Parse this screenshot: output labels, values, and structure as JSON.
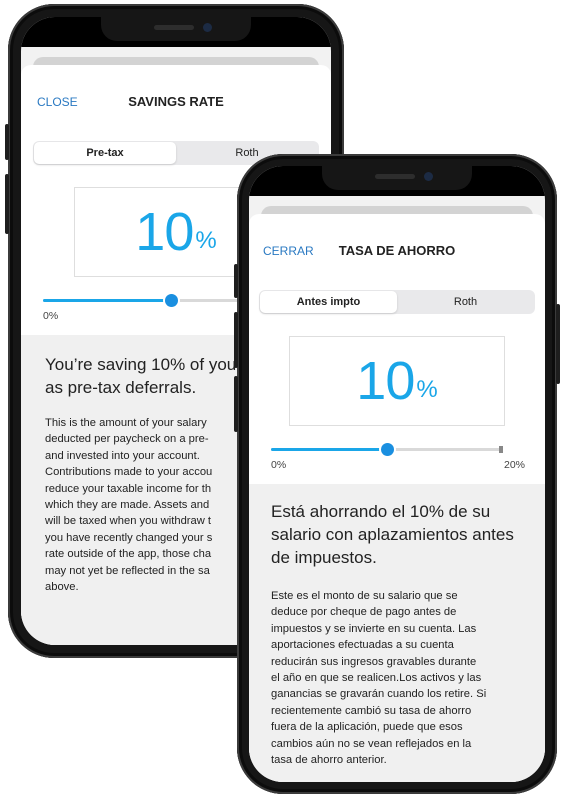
{
  "colors": {
    "accent": "#1aa6e8",
    "link": "#2a79c2",
    "panel": "#f0f0f0",
    "frame": "#161616"
  },
  "english_screen": {
    "close_label": "CLOSE",
    "title": "SAVINGS RATE",
    "tabs": [
      {
        "label": "Pre-tax",
        "selected": true
      },
      {
        "label": "Roth",
        "selected": false
      }
    ],
    "rate_value": "10",
    "rate_unit": "%",
    "slider_value_percent": 10,
    "slider_min_label": "0%",
    "heading_lines": [
      "You’re saving 10% of your",
      "as pre-tax deferrals."
    ],
    "body_lines": [
      "This is the amount of your salary",
      "deducted per paycheck on a pre-",
      "and invested into your account.",
      "Contributions made to your accou",
      "reduce your taxable income for th",
      "which they are made. Assets and",
      "will be taxed when you withdraw t",
      "you have recently changed your s",
      "rate outside of the app, those cha",
      "may not yet be reflected in the sa",
      "above."
    ]
  },
  "spanish_screen": {
    "close_label": "CERRAR",
    "title": "TASA DE AHORRO",
    "tabs": [
      {
        "label": "Antes impto",
        "selected": true
      },
      {
        "label": "Roth",
        "selected": false
      }
    ],
    "rate_value": "10",
    "rate_unit": "%",
    "slider_value_percent": 10,
    "slider_min_label": "0%",
    "slider_max_label": "20%",
    "heading_lines": [
      "Está ahorrando el 10% de su",
      "salario con aplazamientos antes",
      "de impuestos."
    ],
    "body_lines": [
      "Este es el monto de su salario que se",
      "deduce por cheque de pago antes de",
      "impuestos y se invierte en su cuenta. Las",
      "aportaciones efectuadas a su cuenta",
      "reducirán sus ingresos gravables durante",
      "el año en que se realicen.Los activos y las",
      "ganancias se gravarán cuando los retire. Si",
      "recientemente cambió su tasa de ahorro",
      "fuera de la aplicación, puede que esos",
      "cambios aún no se vean reflejados en la",
      "tasa de ahorro anterior."
    ]
  }
}
